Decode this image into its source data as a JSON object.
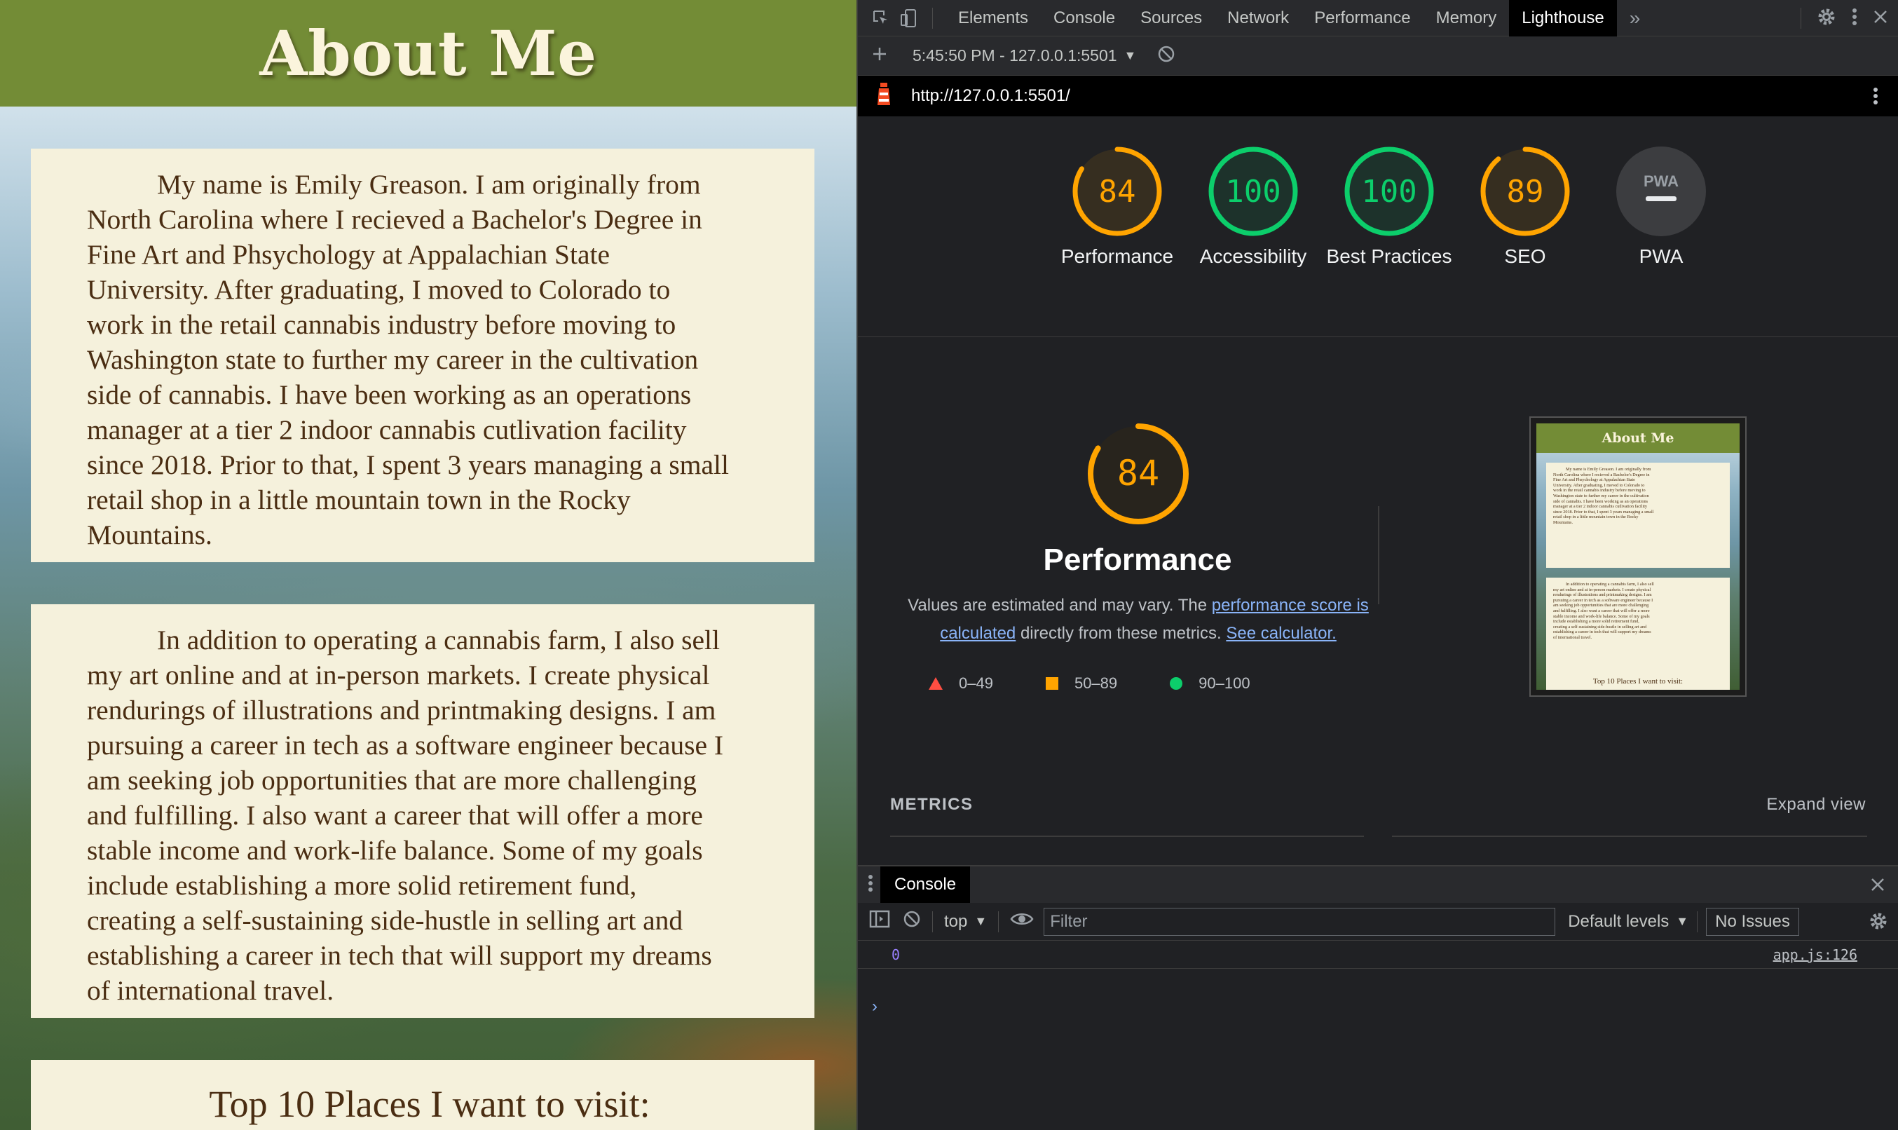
{
  "webpage": {
    "title": "About Me",
    "paragraph1": "My name is Emily Greason. I am originally from\nNorth Carolina where I recieved a Bachelor's Degree in\nFine Art and Phsychology at Appalachian State\nUniversity. After graduating, I moved to Colorado to\nwork in the retail cannabis industry before moving to\nWashington state to further my career in the cultivation\nside of cannabis. I have been working as an operations\nmanager at a tier 2 indoor cannabis cutlivation facility\nsince 2018. Prior to that, I spent 3 years managing a small\nretail shop in a little mountain town in the Rocky\nMountains.",
    "paragraph2": "In addition to operating a cannabis farm, I also sell\nmy art online and at in-person markets. I create physical\nrendurings of illustrations and printmaking designs. I am\npursuing a career in tech as a software engineer because I\nam seeking job opportunities that are more challenging\nand fulfilling. I also want a career that will offer a more\nstable income and work-life balance. Some of my goals\ninclude establishing a more solid retirement fund,\ncreating a self-sustaining side-hustle in selling art and\nestablishing a career in tech that will support my dreams\nof international travel.",
    "section_heading": "Top 10 Places I want to visit:"
  },
  "devtools": {
    "tabs": [
      "Elements",
      "Console",
      "Sources",
      "Network",
      "Performance",
      "Memory",
      "Lighthouse"
    ],
    "active_tab": "Lighthouse",
    "more_tabs": "»",
    "report_time": "5:45:50 PM - 127.0.0.1:5501",
    "url": "http://127.0.0.1:5501/",
    "scores": [
      {
        "label": "Performance",
        "value": "84",
        "score": 84,
        "color": "#ffa400"
      },
      {
        "label": "Accessibility",
        "value": "100",
        "score": 100,
        "color": "#0cce6b"
      },
      {
        "label": "Best Practices",
        "value": "100",
        "score": 100,
        "color": "#0cce6b"
      },
      {
        "label": "SEO",
        "value": "89",
        "score": 89,
        "color": "#ffa400"
      },
      {
        "label": "PWA",
        "value": "PWA",
        "score": null,
        "color": "#9aa0a6"
      }
    ],
    "performance": {
      "score": "84",
      "title": "Performance",
      "desc_prefix": "Values are estimated and may vary. The ",
      "desc_link1": "performance score is calculated",
      "desc_middle": " directly from these metrics. ",
      "desc_link2": "See calculator.",
      "legend": [
        "0–49",
        "50–89",
        "90–100"
      ]
    },
    "metrics_heading": "METRICS",
    "expand_view": "Expand view",
    "drawer": {
      "tab": "Console",
      "context": "top",
      "filter_placeholder": "Filter",
      "levels": "Default levels",
      "issues": "No Issues",
      "log_value": "0",
      "log_source": "app.js:126",
      "prompt": "›"
    },
    "colors": {
      "fail": "#ff4e42",
      "average": "#ffa400",
      "pass": "#0cce6b",
      "link": "#8ab4f8"
    }
  }
}
